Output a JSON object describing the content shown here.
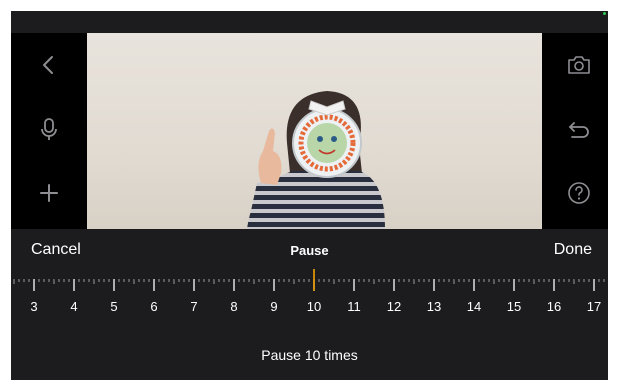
{
  "header": {
    "title": "Pause"
  },
  "toolbar": {
    "cancel_label": "Cancel",
    "done_label": "Done"
  },
  "left_tools": [
    {
      "icon": "chevron-left-icon"
    },
    {
      "icon": "microphone-icon"
    },
    {
      "icon": "plus-icon"
    }
  ],
  "right_tools": [
    {
      "icon": "camera-icon"
    },
    {
      "icon": "undo-icon"
    },
    {
      "icon": "help-icon"
    }
  ],
  "ruler": {
    "ticks": [
      "3",
      "4",
      "5",
      "6",
      "7",
      "8",
      "9",
      "10",
      "11",
      "12",
      "13",
      "14",
      "15",
      "16",
      "17"
    ],
    "selected": 10
  },
  "status": {
    "text": "Pause 10 times"
  },
  "colors": {
    "accent": "#f0a000",
    "background": "#1c1c1e",
    "text": "#ffffff",
    "icon": "#8e8e93"
  }
}
